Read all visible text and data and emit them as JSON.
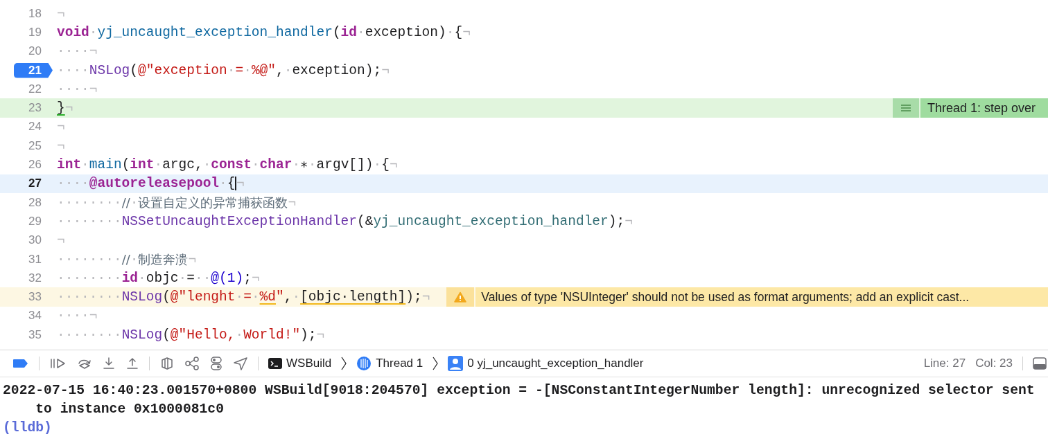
{
  "editor": {
    "lines": [
      {
        "number": "18",
        "breakpoint": false,
        "kind": "plain",
        "tokens": [
          {
            "text": "¬",
            "kind": "ws"
          }
        ]
      },
      {
        "number": "19",
        "breakpoint": false,
        "kind": "plain",
        "tokens": [
          {
            "text": "void",
            "kind": "keyword"
          },
          {
            "text": "·",
            "kind": "ws"
          },
          {
            "text": "yj_uncaught_exception_handler",
            "kind": "decl"
          },
          {
            "text": "(",
            "kind": "plain"
          },
          {
            "text": "id",
            "kind": "keyword"
          },
          {
            "text": "·",
            "kind": "ws"
          },
          {
            "text": "exception)",
            "kind": "plain"
          },
          {
            "text": "·",
            "kind": "ws"
          },
          {
            "text": "{",
            "kind": "plain"
          },
          {
            "text": "¬",
            "kind": "ws"
          }
        ]
      },
      {
        "number": "20",
        "breakpoint": false,
        "kind": "plain",
        "tokens": [
          {
            "text": "····¬",
            "kind": "ws"
          }
        ]
      },
      {
        "number": "21",
        "breakpoint": true,
        "kind": "plain",
        "tokens": [
          {
            "text": "····",
            "kind": "ws"
          },
          {
            "text": "NSLog",
            "kind": "call"
          },
          {
            "text": "(",
            "kind": "plain"
          },
          {
            "text": "@\"exception",
            "kind": "string"
          },
          {
            "text": "·",
            "kind": "ws"
          },
          {
            "text": "=",
            "kind": "string"
          },
          {
            "text": "·",
            "kind": "ws"
          },
          {
            "text": "%@\"",
            "kind": "string"
          },
          {
            "text": ",",
            "kind": "plain"
          },
          {
            "text": "·",
            "kind": "ws"
          },
          {
            "text": "exception);",
            "kind": "plain"
          },
          {
            "text": "¬",
            "kind": "ws"
          }
        ]
      },
      {
        "number": "22",
        "breakpoint": false,
        "kind": "plain",
        "tokens": [
          {
            "text": "····¬",
            "kind": "ws"
          }
        ]
      },
      {
        "number": "23",
        "breakpoint": false,
        "kind": "current",
        "tokens": [
          {
            "text": "}",
            "kind": "plain"
          },
          {
            "text": "¬",
            "kind": "ws"
          }
        ],
        "annotation": {
          "kind": "thread",
          "text": "Thread 1: step over"
        }
      },
      {
        "number": "24",
        "breakpoint": false,
        "kind": "plain",
        "tokens": [
          {
            "text": "¬",
            "kind": "ws"
          }
        ]
      },
      {
        "number": "25",
        "breakpoint": false,
        "kind": "plain",
        "tokens": [
          {
            "text": "¬",
            "kind": "ws"
          }
        ]
      },
      {
        "number": "26",
        "breakpoint": false,
        "kind": "plain",
        "tokens": [
          {
            "text": "int",
            "kind": "keyword"
          },
          {
            "text": "·",
            "kind": "ws"
          },
          {
            "text": "main",
            "kind": "decl"
          },
          {
            "text": "(",
            "kind": "plain"
          },
          {
            "text": "int",
            "kind": "keyword"
          },
          {
            "text": "·",
            "kind": "ws"
          },
          {
            "text": "argc,",
            "kind": "plain"
          },
          {
            "text": "·",
            "kind": "ws"
          },
          {
            "text": "const",
            "kind": "keyword"
          },
          {
            "text": "·",
            "kind": "ws"
          },
          {
            "text": "char",
            "kind": "keyword"
          },
          {
            "text": "·",
            "kind": "ws"
          },
          {
            "text": "∗",
            "kind": "plain"
          },
          {
            "text": "·",
            "kind": "ws"
          },
          {
            "text": "argv[])",
            "kind": "plain"
          },
          {
            "text": "·",
            "kind": "ws"
          },
          {
            "text": "{",
            "kind": "plain"
          },
          {
            "text": "¬",
            "kind": "ws"
          }
        ]
      },
      {
        "number": "27",
        "breakpoint": false,
        "kind": "cursor",
        "tokens": [
          {
            "text": "····",
            "kind": "ws"
          },
          {
            "text": "@autoreleasepool",
            "kind": "keyword"
          },
          {
            "text": "·",
            "kind": "ws"
          },
          {
            "text": "{",
            "kind": "plain"
          },
          {
            "text": "¬",
            "kind": "ws"
          }
        ]
      },
      {
        "number": "28",
        "breakpoint": false,
        "kind": "plain",
        "tokens": [
          {
            "text": "········",
            "kind": "ws"
          },
          {
            "text": "//",
            "kind": "comment"
          },
          {
            "text": "·",
            "kind": "ws"
          },
          {
            "text": "设置自定义的异常捕获函数",
            "kind": "comment"
          },
          {
            "text": "¬",
            "kind": "ws"
          }
        ]
      },
      {
        "number": "29",
        "breakpoint": false,
        "kind": "plain",
        "tokens": [
          {
            "text": "········",
            "kind": "ws"
          },
          {
            "text": "NSSetUncaughtExceptionHandler",
            "kind": "call"
          },
          {
            "text": "(&",
            "kind": "plain"
          },
          {
            "text": "yj_uncaught_exception_handler",
            "kind": "project"
          },
          {
            "text": ");",
            "kind": "plain"
          },
          {
            "text": "¬",
            "kind": "ws"
          }
        ]
      },
      {
        "number": "30",
        "breakpoint": false,
        "kind": "plain",
        "tokens": [
          {
            "text": "¬",
            "kind": "ws"
          }
        ]
      },
      {
        "number": "31",
        "breakpoint": false,
        "kind": "plain",
        "tokens": [
          {
            "text": "········",
            "kind": "ws"
          },
          {
            "text": "//",
            "kind": "comment"
          },
          {
            "text": "·",
            "kind": "ws"
          },
          {
            "text": "制造奔溃",
            "kind": "comment"
          },
          {
            "text": "¬",
            "kind": "ws"
          }
        ]
      },
      {
        "number": "32",
        "breakpoint": false,
        "kind": "plain",
        "tokens": [
          {
            "text": "········",
            "kind": "ws"
          },
          {
            "text": "id",
            "kind": "keyword"
          },
          {
            "text": "·",
            "kind": "ws"
          },
          {
            "text": "objc",
            "kind": "plain"
          },
          {
            "text": "·",
            "kind": "ws"
          },
          {
            "text": "=",
            "kind": "plain"
          },
          {
            "text": "··",
            "kind": "ws"
          },
          {
            "text": "@(1)",
            "kind": "number"
          },
          {
            "text": ";",
            "kind": "plain"
          },
          {
            "text": "¬",
            "kind": "ws"
          }
        ]
      },
      {
        "number": "33",
        "breakpoint": false,
        "kind": "warning",
        "tokens": [
          {
            "text": "········",
            "kind": "ws"
          },
          {
            "text": "NSLog",
            "kind": "call"
          },
          {
            "text": "(",
            "kind": "plain"
          },
          {
            "text": "@\"lenght",
            "kind": "string"
          },
          {
            "text": "·",
            "kind": "ws"
          },
          {
            "text": "=",
            "kind": "string"
          },
          {
            "text": "·",
            "kind": "ws"
          },
          {
            "text": "%d",
            "kind": "string-underlined"
          },
          {
            "text": "\"",
            "kind": "string"
          },
          {
            "text": ",",
            "kind": "plain"
          },
          {
            "text": "·",
            "kind": "ws"
          },
          {
            "text": "[objc·length]",
            "kind": "plain-underlined"
          },
          {
            "text": ");",
            "kind": "plain"
          },
          {
            "text": "¬",
            "kind": "ws"
          }
        ],
        "annotation": {
          "kind": "warning",
          "text": "Values of type 'NSUInteger' should not be used as format arguments; add an explicit cast..."
        }
      },
      {
        "number": "34",
        "breakpoint": false,
        "kind": "plain",
        "tokens": [
          {
            "text": "····¬",
            "kind": "ws"
          }
        ]
      },
      {
        "number": "35",
        "breakpoint": false,
        "kind": "plain",
        "tokens": [
          {
            "text": "········",
            "kind": "ws"
          },
          {
            "text": "NSLog",
            "kind": "call"
          },
          {
            "text": "(",
            "kind": "plain"
          },
          {
            "text": "@\"Hello,",
            "kind": "string"
          },
          {
            "text": "·",
            "kind": "ws"
          },
          {
            "text": "World!\"",
            "kind": "string"
          },
          {
            "text": ");",
            "kind": "plain"
          },
          {
            "text": "¬",
            "kind": "ws"
          }
        ]
      }
    ]
  },
  "debug_bar": {
    "breadcrumbs": [
      {
        "kind": "terminal",
        "label": "WSBuild"
      },
      {
        "kind": "thread",
        "label": "Thread 1"
      },
      {
        "kind": "frame",
        "label": "0 yj_uncaught_exception_handler"
      }
    ],
    "line": "Line: 27",
    "col": "Col: 23"
  },
  "console": [
    {
      "kind": "output",
      "text": "2022-07-15 16:40:23.001570+0800 WSBuild[9018:204570] exception = -[NSConstantIntegerNumber length]: unrecognized selector sent to instance 0x1000081c0"
    },
    {
      "kind": "prompt",
      "text": "(lldb)"
    }
  ]
}
